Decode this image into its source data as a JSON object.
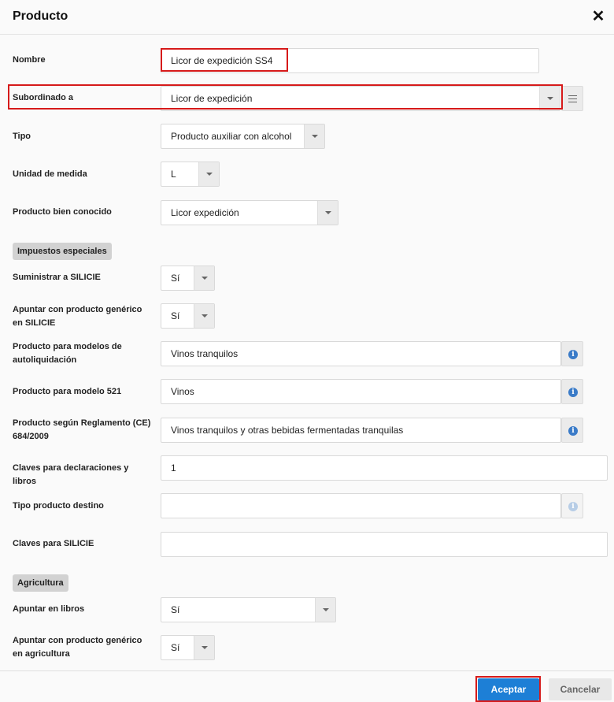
{
  "dialog": {
    "title": "Producto",
    "close_glyph": "✕"
  },
  "fields": {
    "nombre": {
      "label": "Nombre",
      "value": "Licor de expedición SS4"
    },
    "subordinado": {
      "label": "Subordinado a",
      "value": "Licor de expedición",
      "side_icon": "list-menu-icon"
    },
    "tipo": {
      "label": "Tipo",
      "value": "Producto auxiliar con alcohol"
    },
    "unidad": {
      "label": "Unidad de medida",
      "value": "L"
    },
    "bien_conocido": {
      "label": "Producto bien conocido",
      "value": "Licor expedición"
    }
  },
  "sections": {
    "impuestos": "Impuestos especiales",
    "agricultura": "Agricultura"
  },
  "impuestos": {
    "suministrar": {
      "label": "Suministrar a SILICIE",
      "value": "Sí"
    },
    "apuntar_generico": {
      "label": "Apuntar con producto genérico en SILICIE",
      "value": "Sí"
    },
    "modelos_autoliq": {
      "label": "Producto para modelos de autoliquidación",
      "value": "Vinos tranquilos"
    },
    "modelo_521": {
      "label": "Producto para modelo 521",
      "value": "Vinos"
    },
    "reglamento": {
      "label": "Producto según Reglamento (CE) 684/2009",
      "value": "Vinos tranquilos y otras bebidas fermentadas tranquilas"
    },
    "claves_decl": {
      "label": "Claves para declaraciones y libros",
      "value": "1"
    },
    "tipo_destino": {
      "label": "Tipo producto destino",
      "value": ""
    },
    "claves_silicie": {
      "label": "Claves para SILICIE",
      "value": ""
    }
  },
  "agricultura": {
    "apuntar_libros": {
      "label": "Apuntar en libros",
      "value": "Sí"
    },
    "apuntar_generico_agri": {
      "label": "Apuntar con producto genérico en agricultura",
      "value": "Sí"
    }
  },
  "info_glyph": "i",
  "buttons": {
    "accept": "Aceptar",
    "cancel": "Cancelar"
  },
  "colors": {
    "accent": "#1d7fd6",
    "highlight": "#d61a1a",
    "info": "#3a7bc8"
  }
}
